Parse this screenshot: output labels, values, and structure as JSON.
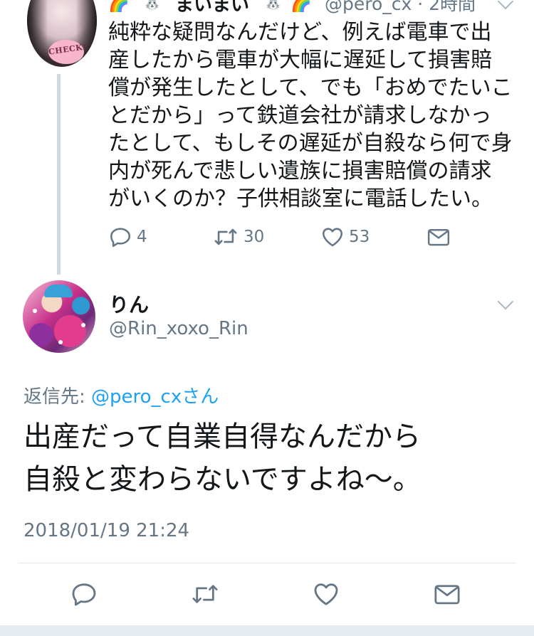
{
  "parent_tweet": {
    "display_name": "まいまい",
    "handle_time": "@pero_cx · 2時間",
    "body_lines": [
      "純粋な疑問なんだけど、例えば電車で出",
      "産したから電車が大幅に遅延して損害賠",
      "償が発生したとして、でも「おめでたいこ",
      "とだから」って鉄道会社が請求しなかっ",
      "たとして、もしその遅延が自殺なら何で身",
      "内が死んで悲しい遺族に損害賠償の請求",
      "がいくのか？子供相談室に電話したい。"
    ],
    "avatar_text": "CHECK!",
    "actions": {
      "reply_count": "4",
      "retweet_count": "30",
      "like_count": "53"
    }
  },
  "reply_tweet": {
    "display_name": "りん",
    "handle": "@Rin_xoxo_Rin",
    "reply_to_label": "返信先: ",
    "reply_to_mention": "@pero_cxさん",
    "body_lines": [
      "出産だって自業自得なんだから",
      "自殺と変わらないですよね〜。"
    ],
    "timestamp": "2018/01/19 21:24"
  },
  "colors": {
    "text": "#14171a",
    "secondary": "#657786",
    "link": "#1da1f2",
    "icon": "#657786",
    "thread_line": "#cfd9de"
  },
  "icons": [
    "reply-icon",
    "retweet-icon",
    "like-icon",
    "dm-icon",
    "chevron-down-icon",
    "rainbow-emoji",
    "rabbit-emoji"
  ]
}
